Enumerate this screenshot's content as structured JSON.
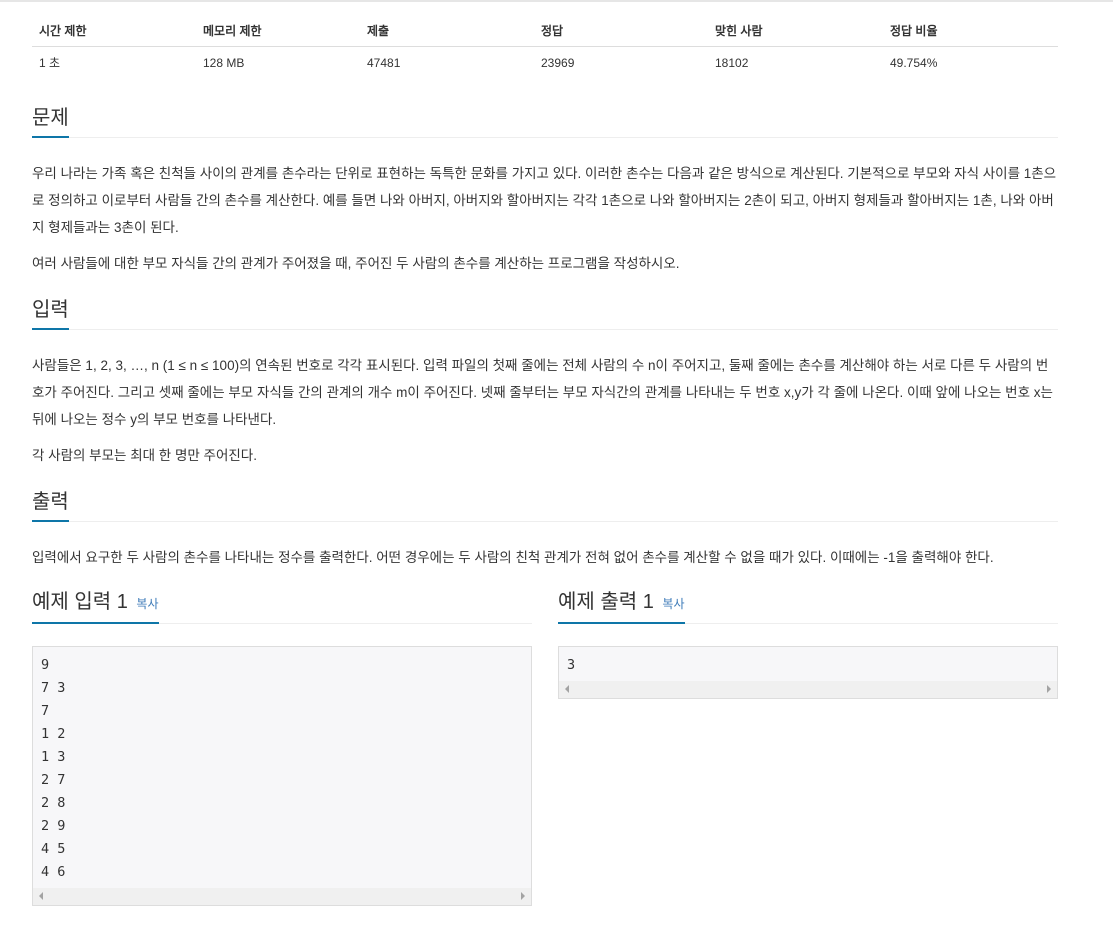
{
  "info_table": {
    "headers": [
      "시간 제한",
      "메모리 제한",
      "제출",
      "정답",
      "맞힌 사람",
      "정답 비율"
    ],
    "values": [
      "1 초",
      "128 MB",
      "47481",
      "23969",
      "18102",
      "49.754%"
    ]
  },
  "problem": {
    "title": "문제",
    "paragraphs": [
      "우리 나라는 가족 혹은 친척들 사이의 관계를 촌수라는 단위로 표현하는 독특한 문화를 가지고 있다. 이러한 촌수는 다음과 같은 방식으로 계산된다. 기본적으로 부모와 자식 사이를 1촌으로 정의하고 이로부터 사람들 간의 촌수를 계산한다. 예를 들면 나와 아버지, 아버지와 할아버지는 각각 1촌으로 나와 할아버지는 2촌이 되고, 아버지 형제들과 할아버지는 1촌, 나와 아버지 형제들과는 3촌이 된다.",
      "여러 사람들에 대한 부모 자식들 간의 관계가 주어졌을 때, 주어진 두 사람의 촌수를 계산하는 프로그램을 작성하시오."
    ]
  },
  "input": {
    "title": "입력",
    "paragraphs": [
      "사람들은 1, 2, 3, …, n (1 ≤ n ≤ 100)의 연속된 번호로 각각 표시된다. 입력 파일의 첫째 줄에는 전체 사람의 수 n이 주어지고, 둘째 줄에는 촌수를 계산해야 하는 서로 다른 두 사람의 번호가 주어진다. 그리고 셋째 줄에는 부모 자식들 간의 관계의 개수 m이 주어진다. 넷째 줄부터는 부모 자식간의 관계를 나타내는 두 번호 x,y가 각 줄에 나온다. 이때 앞에 나오는 번호 x는 뒤에 나오는 정수 y의 부모 번호를 나타낸다.",
      "각 사람의 부모는 최대 한 명만 주어진다."
    ]
  },
  "output": {
    "title": "출력",
    "paragraphs": [
      "입력에서 요구한 두 사람의 촌수를 나타내는 정수를 출력한다. 어떤 경우에는 두 사람의 친척 관계가 전혀 없어 촌수를 계산할 수 없을 때가 있다. 이때에는 -1을 출력해야 한다."
    ]
  },
  "sample_input": {
    "title": "예제 입력 1",
    "copy_label": "복사",
    "content": "9\n7 3\n7\n1 2\n1 3\n2 7\n2 8\n2 9\n4 5\n4 6"
  },
  "sample_output": {
    "title": "예제 출력 1",
    "copy_label": "복사",
    "content": "3"
  },
  "colors": {
    "accent": "#0e76a8",
    "link": "#3c7ab8",
    "sample_bg": "#f7f7f9"
  }
}
